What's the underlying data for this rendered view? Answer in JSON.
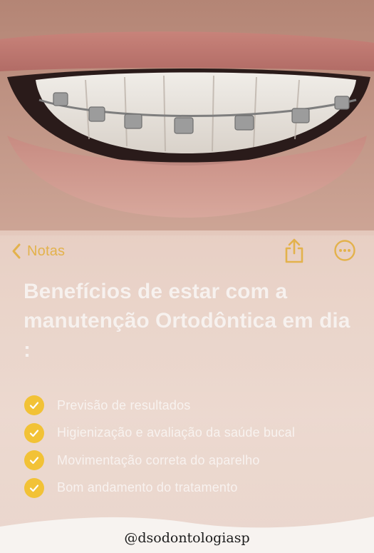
{
  "nav": {
    "back_label": "Notas",
    "icons": [
      "chevron-left-icon",
      "share-icon",
      "more-icon"
    ],
    "accent": "#e3b24c"
  },
  "note": {
    "title": "Benefícios de estar com a manutenção Ortodôntica em dia :",
    "items": [
      "Previsão de resultados",
      "Higienização e avaliação da saúde bucal",
      "Movimentação correta do aparelho",
      "Bom andamento do tratamento"
    ],
    "check_color": "#f2c236"
  },
  "footer": {
    "handle": "@dsodontologiasp"
  }
}
